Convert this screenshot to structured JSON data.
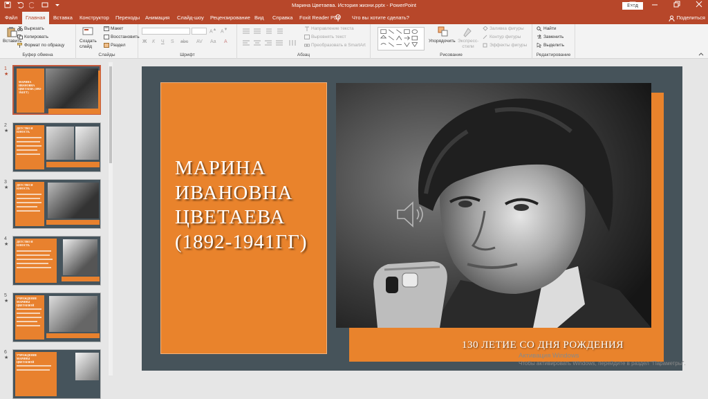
{
  "window": {
    "title": "Марина Цветаева. История жизни.pptx  -  PowerPoint",
    "signin": "Вход",
    "share": "Поделиться"
  },
  "tabs": [
    "Файл",
    "Главная",
    "Вставка",
    "Конструктор",
    "Переходы",
    "Анимация",
    "Слайд-шоу",
    "Рецензирование",
    "Вид",
    "Справка",
    "Foxit Reader PDF",
    "Что вы хотите сделать?"
  ],
  "ribbon": {
    "clipboard": {
      "paste": "Вставить",
      "cut": "Вырезать",
      "copy": "Копировать",
      "format": "Формат по образцу",
      "label": "Буфер обмена"
    },
    "slides": {
      "new_slide": "Создать слайд",
      "layout": "Макет",
      "reset": "Восстановить",
      "section": "Раздел",
      "label": "Слайды"
    },
    "font": {
      "label": "Шрифт"
    },
    "paragraph": {
      "text_direction": "Направление текста",
      "align_text": "Выровнять текст",
      "smartart": "Преобразовать в SmartArt",
      "label": "Абзац"
    },
    "drawing": {
      "arrange": "Упорядочить",
      "quick_styles": "Экспресс-стили",
      "fill": "Заливка фигуры",
      "outline": "Контур фигуры",
      "effects": "Эффекты фигуры",
      "label": "Рисование"
    },
    "editing": {
      "find": "Найти",
      "replace": "Заменить",
      "select": "Выделить",
      "label": "Редактирование"
    }
  },
  "thumbnails": [
    {
      "num": "1",
      "star": "★",
      "title": "МАРИНА ИВАНОВНА ЦВЕТАЕВА (1892-1941ГГ)"
    },
    {
      "num": "2",
      "star": "★",
      "title": "ДЕТСТВО И ЮНОСТЬ"
    },
    {
      "num": "3",
      "star": "★",
      "title": "ДЕТСТВО И ЮНОСТЬ"
    },
    {
      "num": "4",
      "star": "★",
      "title": "ДЕТСТВО И ЮНОСТЬ"
    },
    {
      "num": "5",
      "star": "★",
      "title": "УЧРЕЖДЕНИЕ МАРИНЫ ЦВЕТАЕВОЙ"
    },
    {
      "num": "6",
      "star": "★",
      "title": "УЧРЕЖДЕНИЕ МАРИНЫ ЦВЕТАЕВОЙ"
    }
  ],
  "slide": {
    "title_lines": [
      "МАРИНА",
      "ИВАНОВНА",
      "ЦВЕТАЕВА",
      "(1892-1941ГГ)"
    ],
    "caption": "130 ЛЕТИЕ СО ДНЯ РОЖДЕНИЯ"
  },
  "activation": {
    "line1": "Активация Windows",
    "line2": "Чтобы активировать Windows, перейдите в раздел \"Параметры\"."
  },
  "colors": {
    "accent": "#b7472a",
    "slide_bg": "#46535a",
    "orange": "#e9832c"
  }
}
